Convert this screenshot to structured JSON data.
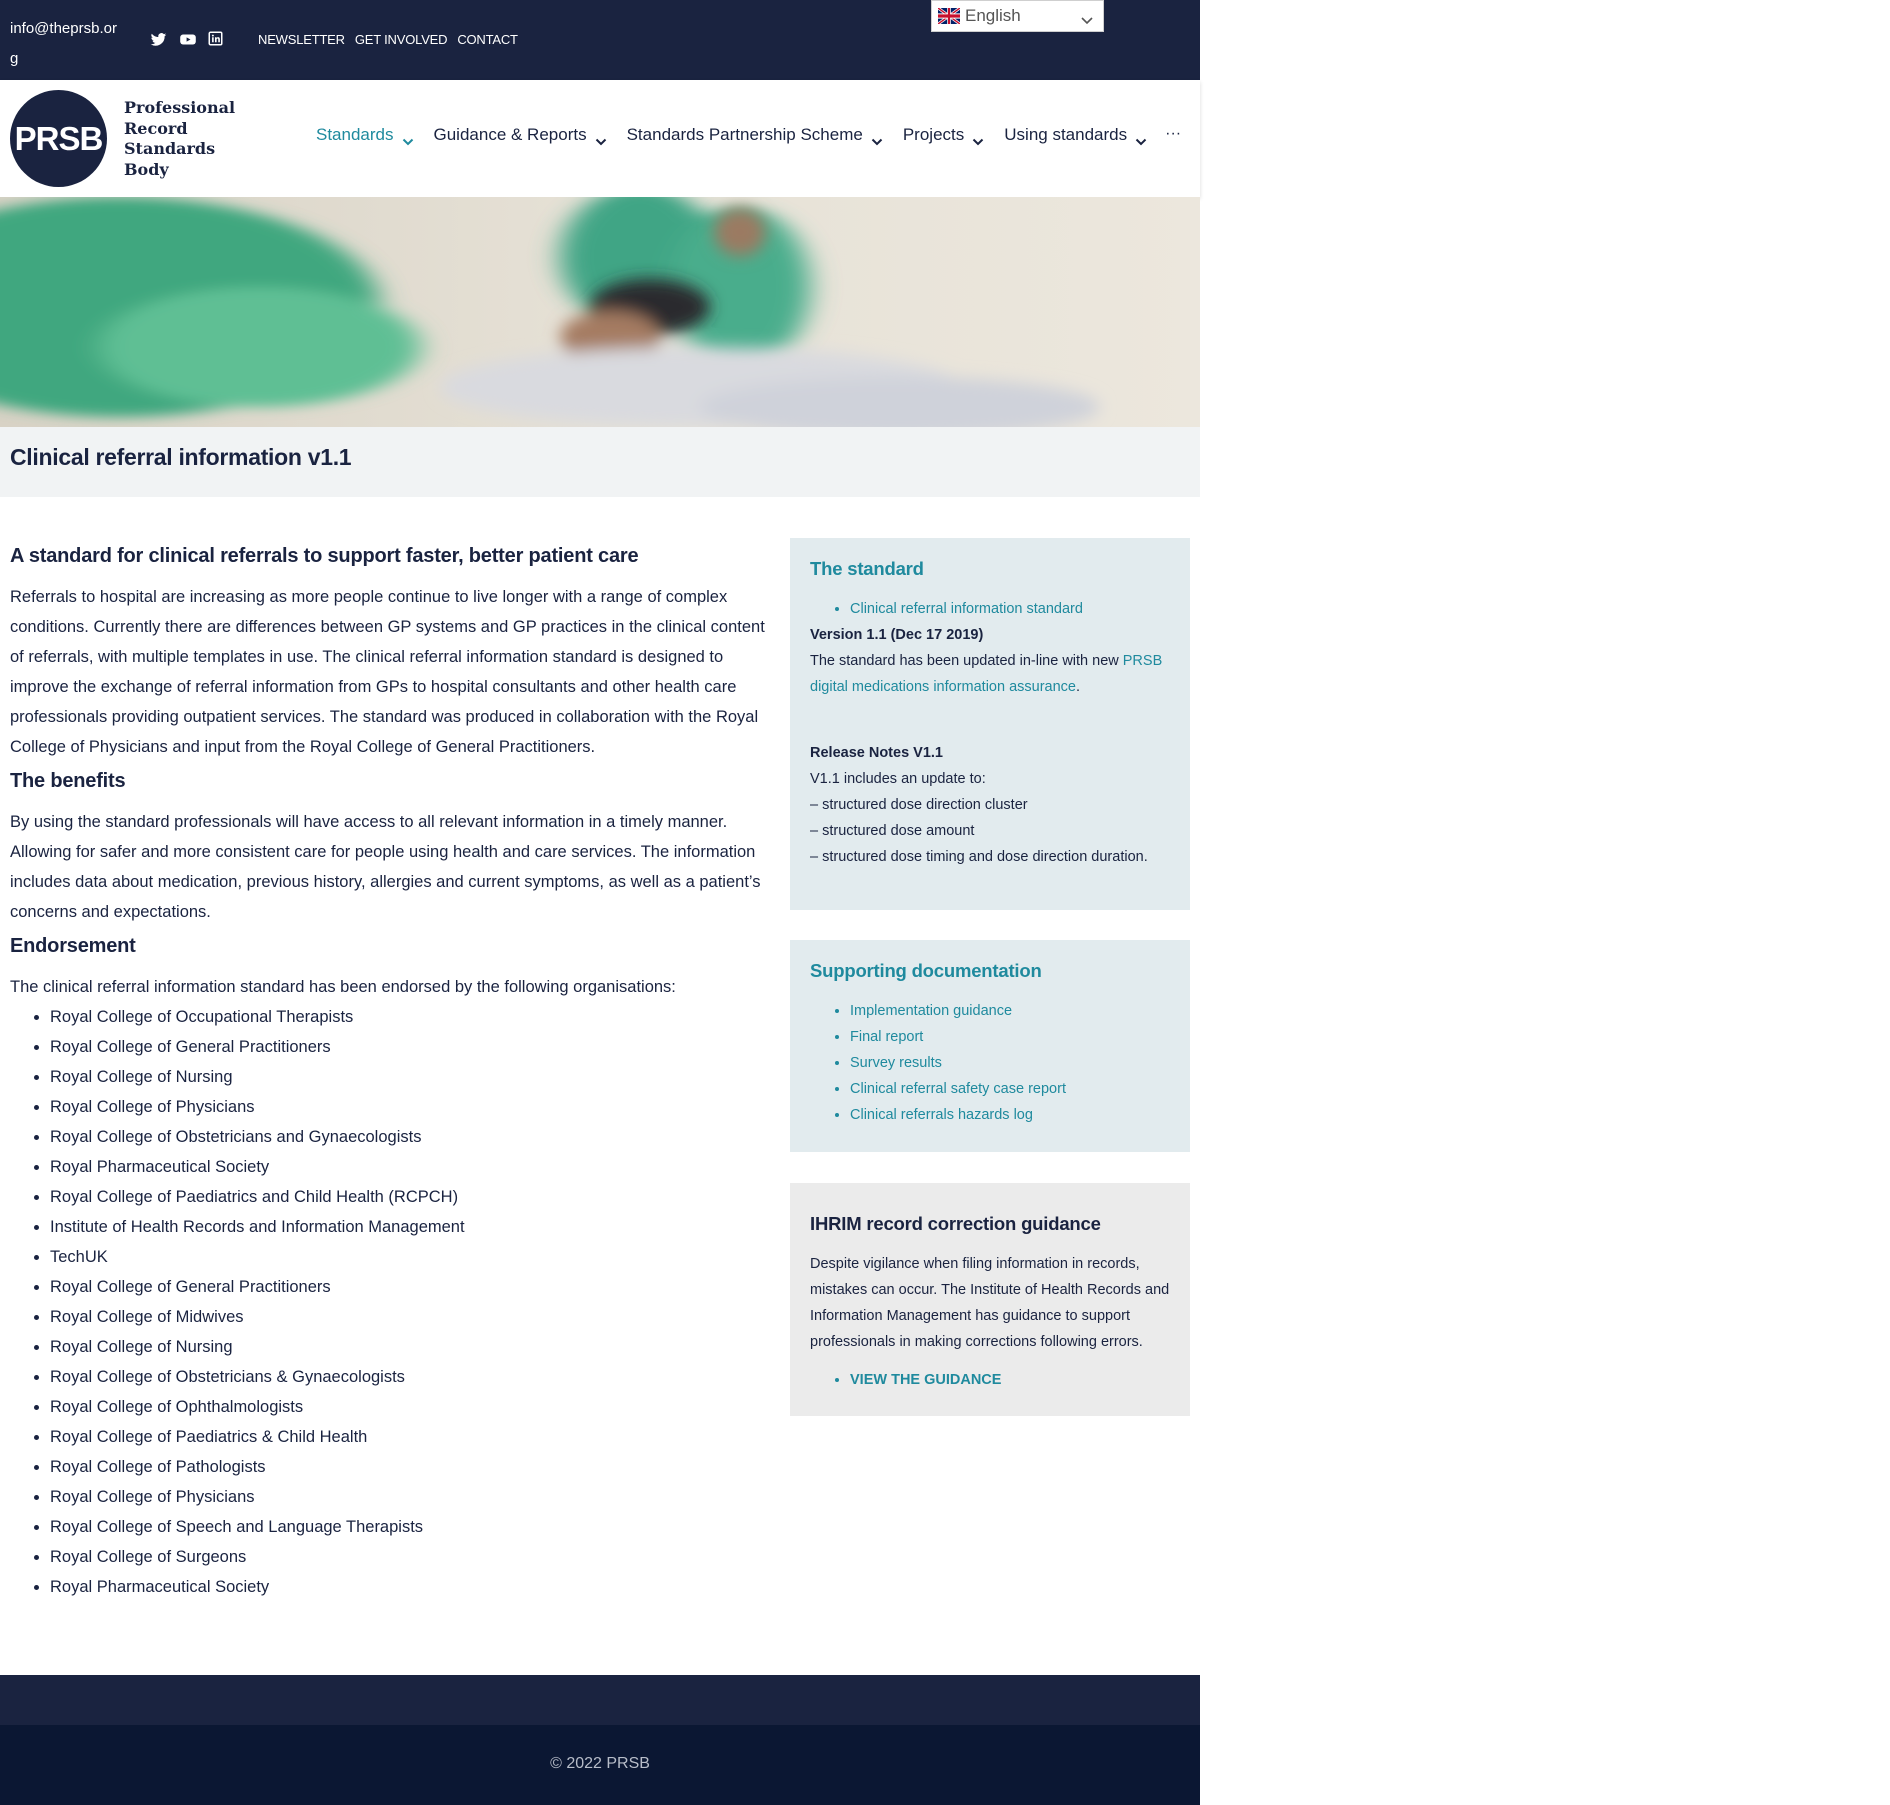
{
  "topbar": {
    "email": "info@theprsb.org",
    "social": [
      "twitter-icon",
      "youtube-icon",
      "linkedin-icon"
    ],
    "links": [
      "NEWSLETTER",
      "GET INVOLVED",
      "CONTACT"
    ],
    "language": "English"
  },
  "header": {
    "logo_abbr": "PRSB",
    "logo_lines": [
      "Professional",
      "Record",
      "Standards",
      "Body"
    ],
    "nav": [
      {
        "label": "Standards",
        "active": true
      },
      {
        "label": "Guidance & Reports",
        "active": false
      },
      {
        "label": "Standards Partnership Scheme",
        "active": false
      },
      {
        "label": "Projects",
        "active": false
      },
      {
        "label": "Using standards",
        "active": false
      }
    ],
    "more": "···"
  },
  "page_title": "Clinical referral information v1.1",
  "main": {
    "heading1": "A standard for clinical referrals to support faster, better patient care",
    "para1": "Referrals to hospital are increasing as more people continue to live longer with a range of complex conditions. Currently there are differences between GP systems and GP practices in the clinical content of referrals, with multiple templates in use. The clinical referral information standard is designed to improve the exchange of referral information from GPs to hospital consultants and other health care professionals providing outpatient services. The standard was produced in collaboration with the Royal College of Physicians and input from the Royal College of General Practitioners.",
    "heading2": "The benefits",
    "para2": "By using the standard professionals will have access to all relevant information in a timely manner. Allowing for safer and more consistent care for people using health and care services. The information includes data about medication, previous history, allergies and current symptoms, as well as a patient’s concerns and expectations.",
    "heading3": "Endorsement",
    "para3": "The clinical referral information standard has been endorsed by the following organisations:",
    "organisations": [
      "Royal College of Occupational Therapists",
      "Royal College of General Practitioners",
      "Royal College of Nursing",
      "Royal College of Physicians",
      "Royal College of Obstetricians and Gynaecologists",
      "Royal Pharmaceutical Society",
      "Royal College of Paediatrics and Child Health (RCPCH)",
      "Institute of Health Records and Information Management",
      "TechUK",
      "Royal College of General Practitioners",
      "Royal College of Midwives",
      "Royal College of Nursing",
      "Royal College of Obstetricians & Gynaecologists",
      "Royal College of Ophthalmologists",
      "Royal College of Paediatrics & Child Health",
      "Royal College of Pathologists",
      "Royal College of Physicians",
      "Royal College of Speech and Language Therapists",
      "Royal College of Surgeons",
      "Royal Pharmaceutical Society"
    ]
  },
  "sidebar": {
    "standard": {
      "title": "The standard",
      "link": "Clinical referral information standard",
      "version": "Version 1.1 (Dec 17 2019)",
      "updated_text": "The standard has been updated in-line with new ",
      "updated_link": "PRSB digital medications information assurance",
      "updated_end": ".",
      "release_title": "Release Notes V1.1",
      "release_lines": [
        "V1.1 includes an update to:",
        "– structured dose direction cluster",
        "– structured dose amount",
        "– structured dose timing and dose direction duration."
      ]
    },
    "supporting": {
      "title": "Supporting documentation",
      "links": [
        "Implementation guidance",
        "Final report",
        "Survey results",
        "Clinical referral safety case report",
        "Clinical referrals hazards log"
      ]
    },
    "ihrim": {
      "title": "IHRIM record correction guidance",
      "text": "Despite vigilance when filing information in records, mistakes can occur. The Institute of Health Records and Information Management has guidance to support professionals in making corrections following errors.",
      "link": "VIEW THE GUIDANCE"
    }
  },
  "footer": {
    "copyright": "© 2022 PRSB"
  },
  "colors": {
    "navy": "#1a2340",
    "teal": "#1f8a9e",
    "footer_dark": "#0b1733"
  }
}
